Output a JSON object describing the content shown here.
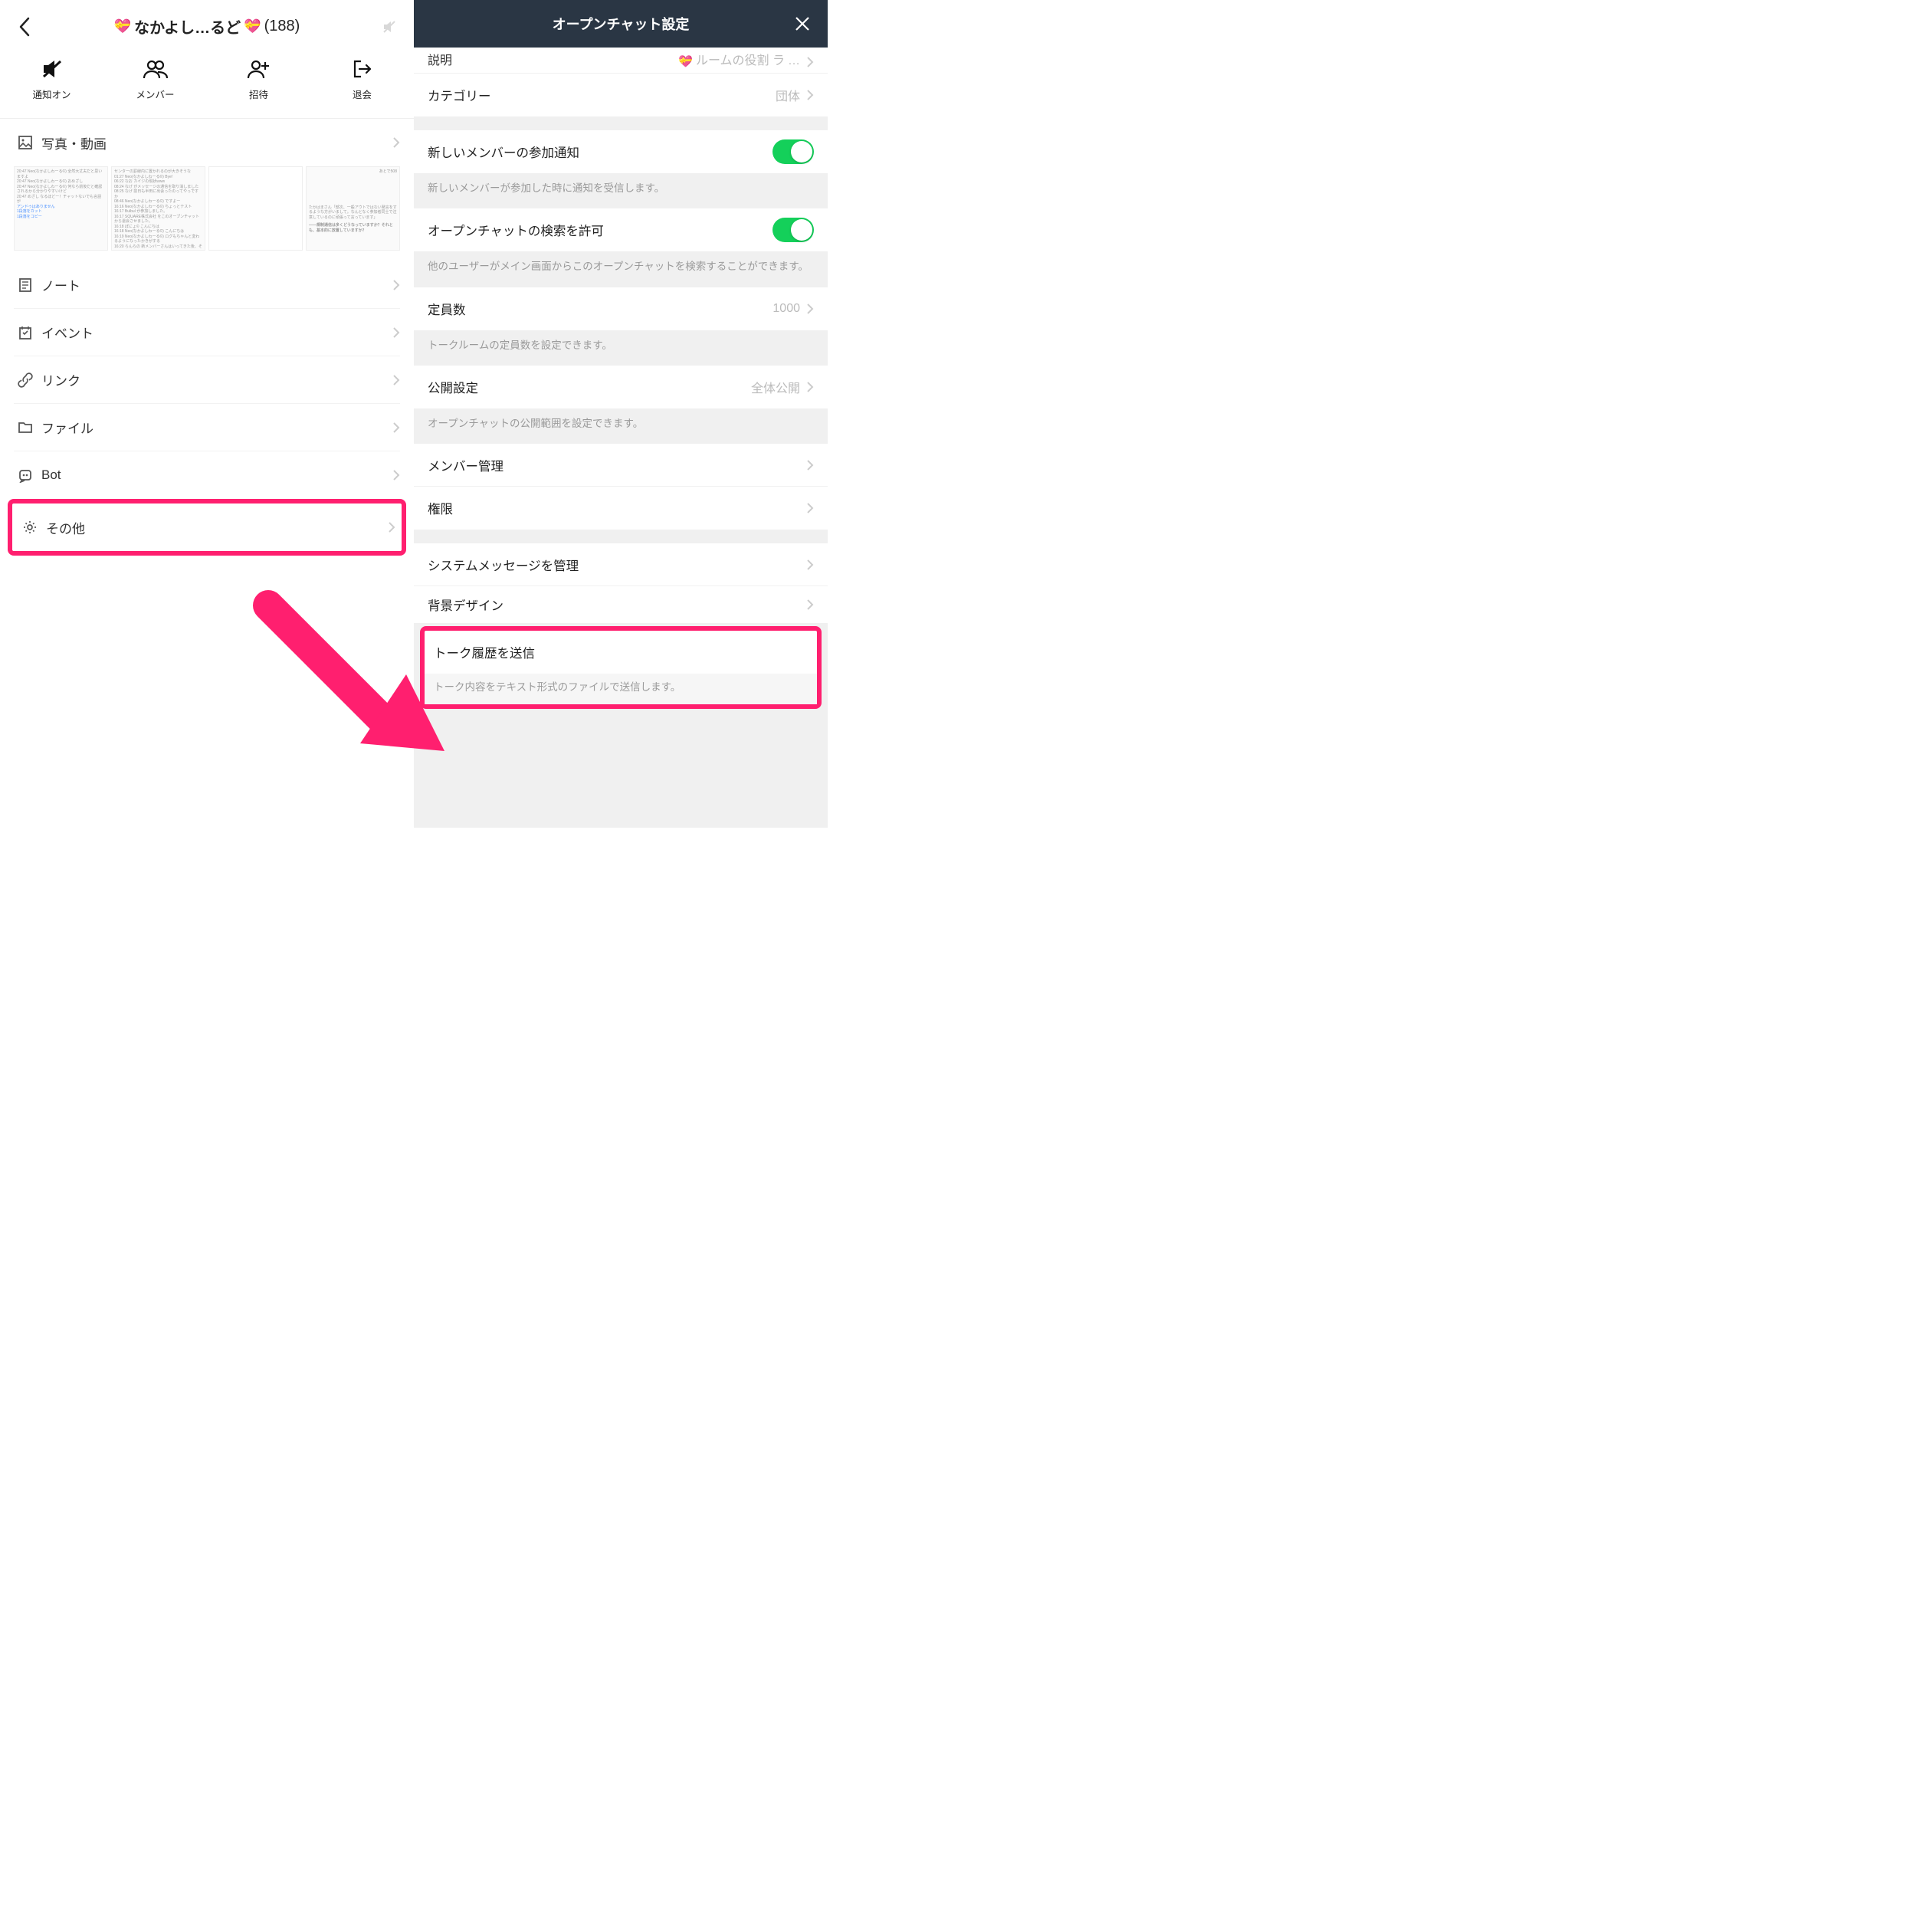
{
  "left": {
    "title": "なかよし…るど",
    "count": "(188)",
    "actions": {
      "notify": "通知オン",
      "members": "メンバー",
      "invite": "招待",
      "leave": "退会"
    },
    "sections": {
      "media": "写真・動画",
      "note": "ノート",
      "event": "イベント",
      "link": "リンク",
      "file": "ファイル",
      "bot": "Bot",
      "other": "その他"
    },
    "thumbs": {
      "t1_l1": "20:47 Neo(なかよしわーる©) 全然大丈夫だと思いますよ",
      "t1_l2": "20:47 Neo(なかよしわーる©) おめざし",
      "t1_l3": "20:47 Neo(なかよしわーる©) 何なら前後だと確認されるから分かりやすいけど",
      "t1_l4": "20:47 めざし なるほどー！チャットないでも言語が",
      "t1_b1": "アンドゥはありません",
      "t1_b2": "1段落をカット",
      "t1_b3": "1段落をコピー",
      "t2_l1": "センターの罫線内に置かれるのが大きそうな",
      "t2_l2": "01:27 Neo(なかよしわーる©) Bye!",
      "t2_l3": "06:22 なお カイジの現状www",
      "t2_l4": "08:24 なげ がメッセージの通信を取り消しました",
      "t2_l5": "08:25 なげ 前日も半田に出会ったのってやっですか",
      "t2_l6": "08:46 Neo(なかよしわーる©) ですよー",
      "t2_l7": "16:16 Neo(なかよしわーる©) ちょっとテスト",
      "t2_l8": "16:17 Bulbul が参加しました。",
      "t2_l9": "16:17 SQUARE株式会社 をこのオープンチャットから退会させました。",
      "t2_l10": "16:18 ぽにょ© こんにちは",
      "t2_l11": "16:18 Neo(なかよしわーる©) こんにちは",
      "t2_l12": "16:19 Neo(なかよしわーる©) ログもちゃんと変わるようになったかきがする",
      "t2_l13": "16:20 らんらの 新メンバーさんはいってきた後、そ",
      "t3_h": "あとで508",
      "t3_p1": "たかはまさん「部次、一般アウトではない発言をするような方がいまして。なんとなく参加者同士で注意しているのに頑張って言っています」",
      "t3_p2": "――規制通信は多くどうなっていますか？それとも、基本的に放置していますか？"
    }
  },
  "right": {
    "header": "オープンチャット設定",
    "rows": {
      "desc_partial_label": "説明",
      "desc_partial_val": "ルームの役割 ラ",
      "category_label": "カテゴリー",
      "category_val": "団体",
      "new_member_label": "新しいメンバーの参加通知",
      "new_member_desc": "新しいメンバーが参加した時に通知を受信します。",
      "search_label": "オープンチャットの検索を許可",
      "search_desc": "他のユーザーがメイン画面からこのオープンチャットを検索することができます。",
      "capacity_label": "定員数",
      "capacity_val": "1000",
      "capacity_desc": "トークルームの定員数を設定できます。",
      "public_label": "公開設定",
      "public_val": "全体公開",
      "public_desc": "オープンチャットの公開範囲を設定できます。",
      "member_mgmt": "メンバー管理",
      "perm": "権限",
      "sysmsg": "システムメッセージを管理",
      "bgdesign": "背景デザイン",
      "sendhistory": "トーク履歴を送信",
      "sendhistory_desc": "トーク内容をテキスト形式のファイルで送信します。"
    }
  }
}
